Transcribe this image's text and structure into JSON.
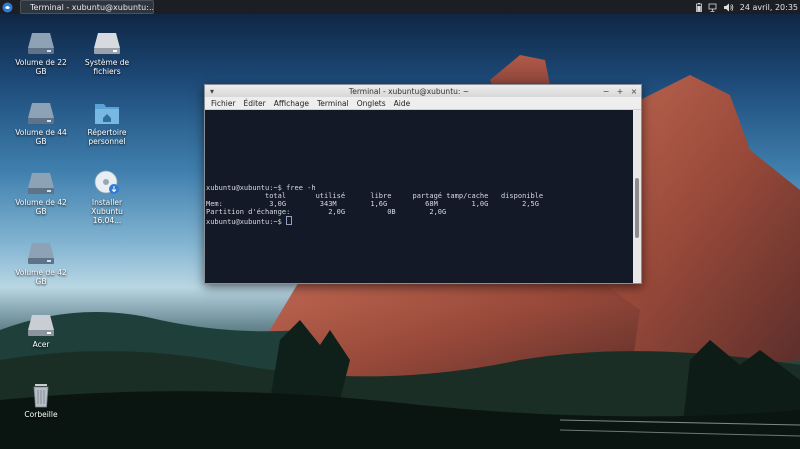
{
  "panel": {
    "task_title": "Terminal - xubuntu@xubuntu:...",
    "clock": "24 avril, 20:35",
    "tray_icons": [
      "battery-icon",
      "network-icon",
      "volume-icon"
    ]
  },
  "desktop": {
    "icons": [
      {
        "label": "Volume de 22 GB",
        "icon": "drive-icon"
      },
      {
        "label": "Système de fichiers",
        "icon": "drive-icon"
      },
      {
        "label": "Volume de 44 GB",
        "icon": "drive-icon"
      },
      {
        "label": "Répertoire personnel",
        "icon": "home-folder-icon"
      },
      {
        "label": "Volume de 42 GB",
        "icon": "drive-icon"
      },
      {
        "label": "Installer Xubuntu 16.04...",
        "icon": "install-disc-icon"
      },
      {
        "label": "Volume de 42 GB",
        "icon": "drive-icon"
      },
      {
        "label": "Acer",
        "icon": "drive-icon"
      },
      {
        "label": "Corbeille",
        "icon": "trash-icon"
      }
    ]
  },
  "terminal": {
    "title": "Terminal - xubuntu@xubuntu: ~",
    "menu": [
      "Fichier",
      "Éditer",
      "Affichage",
      "Terminal",
      "Onglets",
      "Aide"
    ],
    "lines": [
      "xubuntu@xubuntu:~$ free -h",
      "              total       utilisé      libre     partagé tamp/cache   disponible",
      "Mem:           3,0G        343M        1,6G         68M        1,0G        2,5G",
      "Partition d'échange:         2,0G          0B        2,0G",
      "xubuntu@xubuntu:~$ "
    ]
  }
}
